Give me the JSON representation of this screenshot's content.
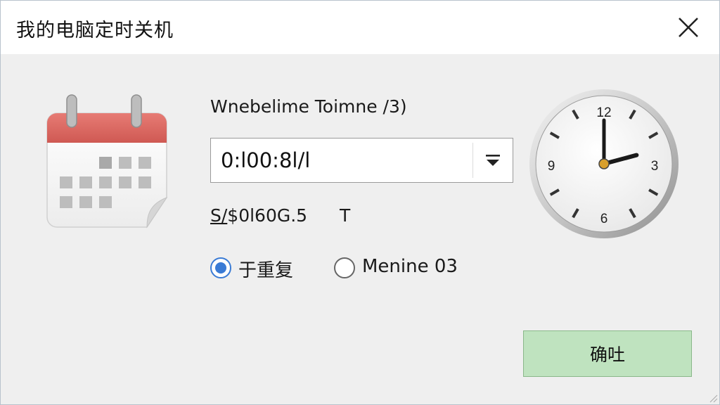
{
  "window": {
    "title": "我的电脑定时关机",
    "close_icon": "close-icon"
  },
  "main": {
    "time_label": "Wnebelime Toimne /3)",
    "time_select": {
      "value": "0:l00:8l/l",
      "icon": "dropdown-arrow-icon"
    },
    "info": {
      "underlined": "S/",
      "text": "$0l60G.5",
      "suffix": "T"
    },
    "radios": [
      {
        "label": "于重复",
        "checked": true
      },
      {
        "label": "Menine 03",
        "checked": false
      }
    ],
    "ok_label": "确吐"
  },
  "icons": {
    "calendar": "calendar-icon",
    "clock": "clock-icon"
  },
  "colors": {
    "accent": "#3a7bd5",
    "ok_button": "#bfe3bf",
    "calendar_header": "#d9625e"
  },
  "clock": {
    "numerals": [
      "12",
      "3",
      "6",
      "9"
    ],
    "hour_hand_deg": 75,
    "minute_hand_deg": 0
  }
}
